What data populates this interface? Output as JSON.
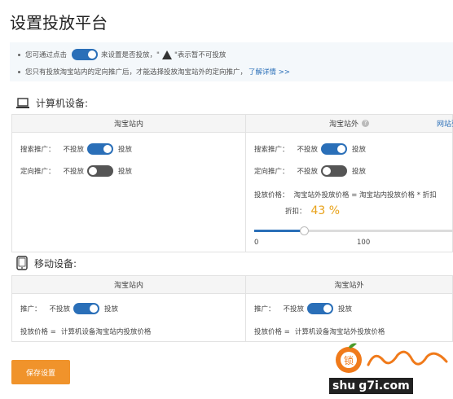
{
  "page_title": "设置投放平台",
  "notice": {
    "line1_prefix": "您可通过点击",
    "line1_middle": "来设置是否投放，\"",
    "line1_suffix": "\"表示暂不可投放",
    "line2_text": "您只有投放淘宝站内的定向推广后，才能选择投放淘宝站外的定向推广，",
    "line2_link": "了解详情 >>"
  },
  "pc_section": {
    "title": "计算机设备:",
    "inner_head": "淘宝站内",
    "outer_head": "淘宝站外",
    "outer_extra": "网站列",
    "inner": {
      "search_label": "搜索推广：",
      "search_off": "不投放",
      "search_on": "投放",
      "search_state": true,
      "target_label": "定向推广：",
      "target_off": "不投放",
      "target_on": "投放",
      "target_state": false
    },
    "outer": {
      "search_label": "搜索推广：",
      "search_off": "不投放",
      "search_on": "投放",
      "search_state": true,
      "target_label": "定向推广：",
      "target_off": "不投放",
      "target_on": "投放",
      "target_state": false,
      "price_label": "投放价格：",
      "price_formula": "淘宝站外投放价格 = 淘宝站内投放价格 * 折扣",
      "discount_label": "折扣：",
      "discount_value": "43 %",
      "slider_fraction": 0.43,
      "slider_min": "0",
      "slider_max": "100"
    }
  },
  "mobile_section": {
    "title": "移动设备:",
    "inner_head": "淘宝站内",
    "outer_head": "淘宝站外",
    "inner": {
      "promo_label": "推广：",
      "promo_off": "不投放",
      "promo_on": "投放",
      "promo_state": true,
      "price_label": "投放价格 =",
      "price_value": "计算机设备淘宝站内投放价格"
    },
    "outer": {
      "promo_label": "推广：",
      "promo_off": "不投放",
      "promo_on": "投放",
      "promo_state": true,
      "price_label": "投放价格 =",
      "price_value": "计算机设备淘宝站外投放价格"
    }
  },
  "save_button": "保存设置",
  "watermark": {
    "brand": "shu",
    "brand_tail": "g7i.com",
    "mascot_text": "锁",
    "logo_icon": "fruit-mascot-icon"
  },
  "colors": {
    "accent": "#2a6fb8",
    "save": "#f0932b",
    "discount": "#e8a21a"
  }
}
